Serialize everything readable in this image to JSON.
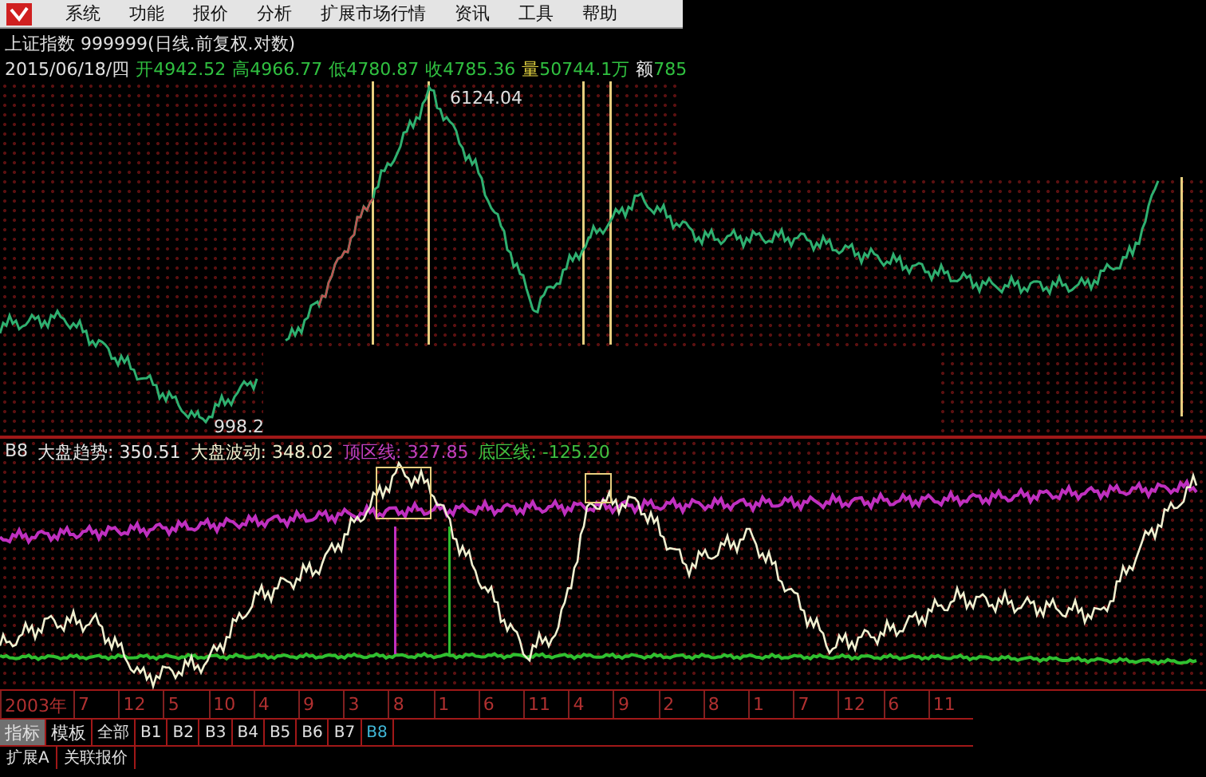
{
  "menu": [
    "系统",
    "功能",
    "报价",
    "分析",
    "扩展市场行情",
    "资讯",
    "工具",
    "帮助"
  ],
  "header": {
    "title": "上证指数 999999(日线.前复权.对数)",
    "date": "2015/06/18/四",
    "quotes": [
      {
        "label": "开",
        "value": "4942.52",
        "color": "#30c040"
      },
      {
        "label": "高",
        "value": "4966.77",
        "color": "#30c040"
      },
      {
        "label": "低",
        "value": "4780.87",
        "color": "#30c040"
      },
      {
        "label": "收",
        "value": "4785.36",
        "color": "#30c040"
      },
      {
        "label": "量",
        "value": "50744.1万",
        "color": "#e0d040"
      },
      {
        "label": "额",
        "value": "785",
        "color": "#e8e8e8"
      }
    ]
  },
  "price_chart": {
    "high_label": "6124.04",
    "low_label": "998.2"
  },
  "indicator": {
    "name": "B8",
    "legend": [
      {
        "label": "大盘趋势:",
        "value": "350.51",
        "color": "#e8e8e8"
      },
      {
        "label": "大盘波动:",
        "value": "348.02",
        "color": "#f0f0d0"
      },
      {
        "label": "顶区线:",
        "value": "327.85",
        "color": "#c040c0"
      },
      {
        "label": "底区线:",
        "value": "-125.20",
        "color": "#40c040"
      }
    ]
  },
  "time_axis": [
    "2003年",
    "7",
    "12",
    "5",
    "10",
    "4",
    "9",
    "3",
    "8",
    "1",
    "6",
    "11",
    "4",
    "9",
    "2",
    "8",
    "1",
    "7",
    "12",
    "6",
    "11"
  ],
  "view_tabs": [
    {
      "label": "指标",
      "selected": true
    },
    {
      "label": "模板",
      "selected": false
    }
  ],
  "formula_tabs": [
    {
      "label": "全部",
      "selected": false
    },
    {
      "label": "B1",
      "selected": false
    },
    {
      "label": "B2",
      "selected": false
    },
    {
      "label": "B3",
      "selected": false
    },
    {
      "label": "B4",
      "selected": false
    },
    {
      "label": "B5",
      "selected": false
    },
    {
      "label": "B6",
      "selected": false
    },
    {
      "label": "B7",
      "selected": false
    },
    {
      "label": "B8",
      "selected": true
    }
  ],
  "bottom_tabs": [
    "扩展A",
    "关联报价"
  ]
}
